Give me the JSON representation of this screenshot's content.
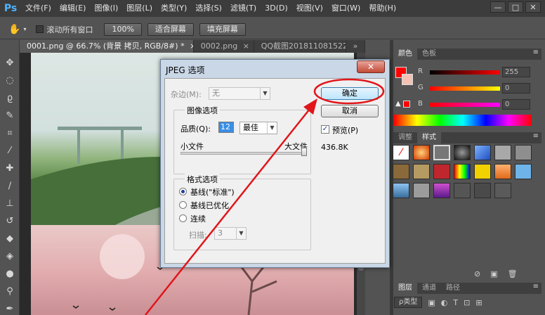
{
  "app": {
    "logo": "Ps"
  },
  "menu": [
    "文件(F)",
    "编辑(E)",
    "图像(I)",
    "图层(L)",
    "类型(Y)",
    "选择(S)",
    "滤镜(T)",
    "3D(D)",
    "视图(V)",
    "窗口(W)",
    "帮助(H)"
  ],
  "window_controls": [
    "—",
    "□",
    "✕"
  ],
  "options": {
    "scroll_all_label": "滚动所有窗口",
    "zoom_100": "100%",
    "fit_screen": "适合屏幕",
    "fill_screen": "填充屏幕"
  },
  "tabs": [
    {
      "label": "0001.png @ 66.7% (背景 拷贝, RGB/8#) *",
      "close": "×"
    },
    {
      "label": "0002.png",
      "close": "×"
    },
    {
      "label": "QQ截图20181108152204.pn",
      "close": ""
    }
  ],
  "tab_overflow": "»",
  "dialog": {
    "title": "JPEG 选项",
    "close": "✕",
    "matte_label": "杂边(M):",
    "matte_value": "无",
    "image_options_title": "图像选项",
    "quality_label": "品质(Q):",
    "quality_value": "12",
    "quality_preset": "最佳",
    "small_file": "小文件",
    "large_file": "大文件",
    "format_options_title": "格式选项",
    "format_options": [
      {
        "label": "基线(\"标准\")",
        "selected": true
      },
      {
        "label": "基线已优化",
        "selected": false
      },
      {
        "label": "连续",
        "selected": false
      }
    ],
    "scans_label": "扫描:",
    "scans_value": "3",
    "ok": "确定",
    "cancel": "取消",
    "preview_label": "预览(P)",
    "preview_checked": true,
    "file_size": "436.8K"
  },
  "color_panel": {
    "tabs": [
      "颜色",
      "色板"
    ],
    "channels": [
      {
        "label": "R",
        "value": "255",
        "gradient": [
          "#000000",
          "#ff0000"
        ]
      },
      {
        "label": "G",
        "value": "0",
        "gradient": [
          "#ff0000",
          "#ffff00"
        ]
      },
      {
        "label": "B",
        "value": "0",
        "gradient": [
          "#ff0000",
          "#ff00ff"
        ]
      }
    ],
    "foreground": "#ff0000",
    "background": "#f4c2b4"
  },
  "styles_panel": {
    "tabs": [
      "调整",
      "样式"
    ]
  },
  "layers_panel": {
    "tabs": [
      "图层",
      "通道",
      "路径"
    ],
    "filter_label": "ρ类型"
  },
  "colors": {
    "accent": "#ff0000",
    "annotation": "#e0161b"
  }
}
